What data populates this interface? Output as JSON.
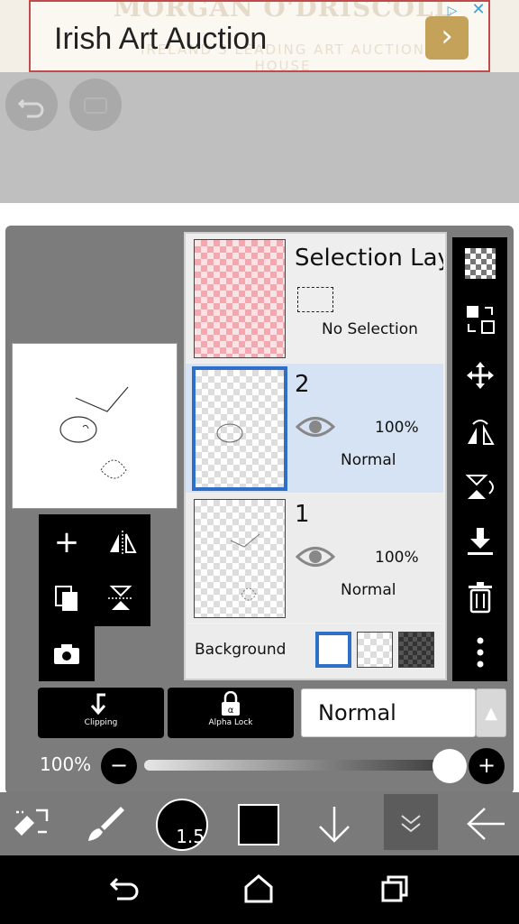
{
  "ad": {
    "title": "Irish Art Auction",
    "watermark": "MORGAN O'DRISCOLL",
    "watermark_sub": "IRELAND'S LEADING ART AUCTION HOUSE"
  },
  "layers": {
    "selection": {
      "name": "Selection Layer",
      "status": "No Selection"
    },
    "items": [
      {
        "name": "2",
        "opacity": "100%",
        "blend": "Normal",
        "selected": true
      },
      {
        "name": "1",
        "opacity": "100%",
        "blend": "Normal",
        "selected": false
      }
    ],
    "background_label": "Background"
  },
  "controls": {
    "clipping_label": "Clipping",
    "alpha_lock_label": "Alpha Lock",
    "blend_mode": "Normal",
    "opacity_label": "100%",
    "opacity_value": 1.0
  },
  "toolbar": {
    "brush_size": "1.5"
  },
  "colors": {
    "accent": "#2f6fc7",
    "selected_row": "#d5e3f4",
    "foreground": "#000000"
  }
}
